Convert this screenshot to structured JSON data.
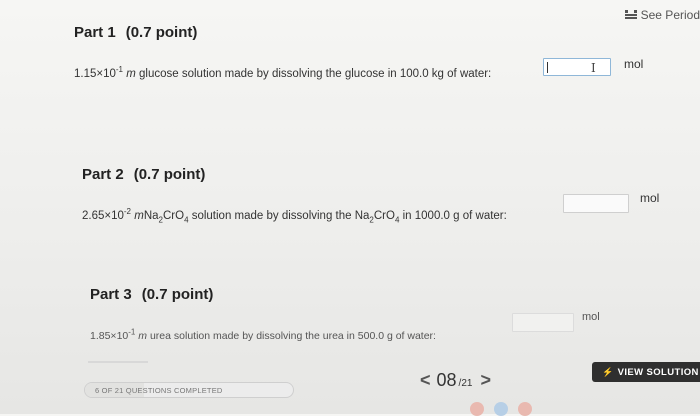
{
  "header": {
    "periodic_label": "See Period"
  },
  "parts": [
    {
      "title": "Part 1",
      "points": "(0.7 point)",
      "coeff": "1.15×10",
      "exp": "-1",
      "m": "m",
      "pre": "glucose solution made by dissolving the glucose in 100.0 kg of water:",
      "unit": "mol"
    },
    {
      "title": "Part 2",
      "points": "(0.7 point)",
      "coeff": "2.65×10",
      "exp": "-2",
      "m": "m",
      "f1": "Na",
      "s1": "2",
      "f2": "CrO",
      "s2": "4",
      "mid": " solution made by dissolving the Na",
      "s3": "2",
      "f3": "CrO",
      "s4": "4",
      "post": " in 1000.0 g of water:",
      "unit": "mol"
    },
    {
      "title": "Part 3",
      "points": "(0.7 point)",
      "coeff": "1.85×10",
      "exp": "-1",
      "m": "m",
      "pre": "urea solution made by dissolving the urea in 500.0 g of water:",
      "unit": "mol"
    }
  ],
  "footer": {
    "progress_label": "6 OF 21 QUESTIONS COMPLETED",
    "progress_fraction": 0.2857,
    "prev_arrow": "<",
    "next_arrow": ">",
    "current": "08",
    "total": "/21",
    "view_solution": "VIEW SOLUTION",
    "view_solution_icon": "⚡"
  },
  "colors": {
    "button_bg": "#2f2f2f",
    "input_focus": "#8fb7d8"
  }
}
